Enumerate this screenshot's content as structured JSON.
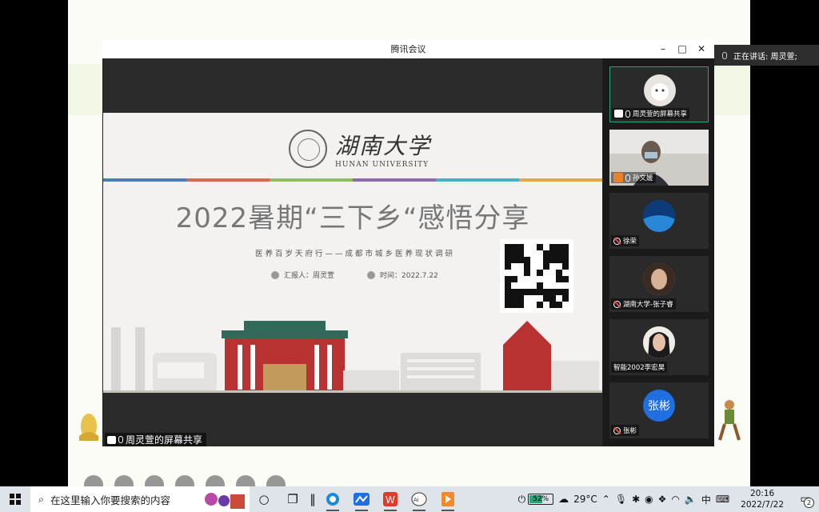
{
  "window": {
    "title": "腾讯会议",
    "minimize": "–",
    "maximize": "□",
    "close": "✕"
  },
  "slide": {
    "logo_cn": "湖南大学",
    "logo_en": "HUNAN UNIVERSITY",
    "title": "2022暑期“三下乡“感悟分享",
    "subtitle": "医养百岁天府行——成都市城乡医养现状调研",
    "reporter": "汇报人：周灵萱",
    "time": "时间：2022.7.22",
    "stripe_colors": [
      "#4a7cc0",
      "#d66a52",
      "#8dbf56",
      "#8b6bb0",
      "#4ab0c8",
      "#e6a64a"
    ]
  },
  "share_label": "周灵萱的屏幕共享",
  "participants": [
    {
      "name": "周灵萱的屏幕共享",
      "status": "sharing",
      "avatar_color": "#e8e4e0"
    },
    {
      "name": "孙文媛",
      "status": "video",
      "avatar_color": "#b8bcc4"
    },
    {
      "name": "徐荣",
      "status": "muted",
      "avatar_color": "#1e5aa8"
    },
    {
      "name": "湖南大学-张子睿",
      "status": "muted",
      "avatar_color": "#c49a78"
    },
    {
      "name": "智能2002李宏昊",
      "status": "none",
      "avatar_color": "#e8d4c8"
    },
    {
      "name": "张彬",
      "status": "muted",
      "avatar_text": "张彬",
      "avatar_color": "#1f6fe0"
    }
  ],
  "speaking": "正在讲话: 周灵萱;",
  "taskbar": {
    "search_placeholder": "在这里输入你要搜索的内容",
    "battery": "52%",
    "battery_level": 0.52,
    "weather": "29°C",
    "ime": "中",
    "time": "20:16",
    "date": "2022/7/22",
    "notifications": "2"
  }
}
